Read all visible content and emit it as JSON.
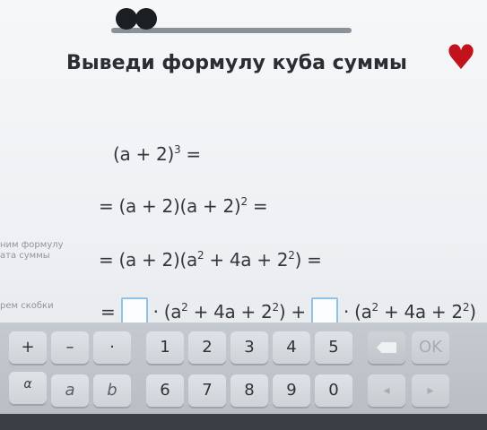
{
  "header": {
    "progress_dots": 2
  },
  "title": "Выведи формулу куба суммы",
  "hints": [
    {
      "text": "ним формулу\nата суммы"
    },
    {
      "text": "рем скобки"
    }
  ],
  "steps": [
    {
      "base": "(a + 2)",
      "exp": "3",
      "tail": " ="
    },
    {
      "prefix": "= (a + 2)(a + 2)",
      "exp": "2",
      "tail": " ="
    },
    {
      "text_a": "= (a + 2)(a",
      "exp_a": "2",
      "text_b": " + 4a + 2",
      "exp_b": "2",
      "tail": ") ="
    },
    {
      "lead": "=",
      "mid1": "· (a",
      "exp1": "2",
      "mid2": " + 4a + 2",
      "exp2": "2",
      "mid3": ") +",
      "mid4": "· (a",
      "exp3": "2",
      "mid5": " + 4a + 2",
      "exp4": "2",
      "tail": ")"
    }
  ],
  "keypad": {
    "row1": [
      "+",
      "–",
      "·",
      "1",
      "2",
      "3",
      "4",
      "5",
      "",
      "OK"
    ],
    "row2": [
      "α",
      "a",
      "b",
      "6",
      "7",
      "8",
      "9",
      "0",
      "◂",
      "▸"
    ]
  },
  "colors": {
    "heart": "#c2121c",
    "answer_box_border": "#8fc3e6"
  }
}
